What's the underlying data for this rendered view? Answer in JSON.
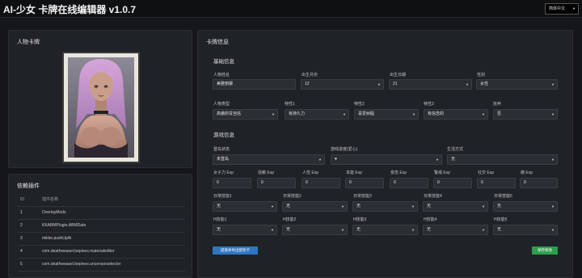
{
  "app": {
    "title": "AI-少女 卡牌在线编辑器 v1.0.7",
    "language": "简体中文"
  },
  "card_panel": {
    "title": "人物卡牌"
  },
  "deps_panel": {
    "title": "依赖插件",
    "columns": [
      "ID",
      "插件名称"
    ],
    "rows": [
      [
        "1",
        "OverlayMods"
      ],
      [
        "2",
        "KKABMPlugin.ABMData"
      ],
      [
        "3",
        "mikke.pushUpAI"
      ],
      [
        "4",
        "com.deathweasel.bepinex.materialeditor"
      ],
      [
        "5",
        "com.deathweasel.bepinex.uncensorselector"
      ]
    ]
  },
  "info_panel": {
    "title": "卡牌信息",
    "basic": {
      "title": "基础信息",
      "name_label": "人物姓名",
      "name_value": "美雅丽娜",
      "month_label": "出生月份",
      "month_value": "12",
      "day_label": "出生日期",
      "day_value": "21",
      "gender_label": "性别",
      "gender_value": "女性",
      "personality_label": "人物类型",
      "personality_value": "高傲的甘自信",
      "trait1_label": "特性1",
      "trait1_value": "有持久力",
      "trait2_label": "特性2",
      "trait2_value": "喜爱树脂",
      "trait3_label": "特性3",
      "trait3_value": "有信念的",
      "blood_label": "抚养",
      "blood_value": "否"
    },
    "game": {
      "title": "游戏信息",
      "status_label": "登岛状态",
      "status_value": "未登岛",
      "fav_label": "游戏进度(爱心)",
      "fav_value": "♥",
      "life_label": "生活方式",
      "life_value": "无",
      "exps": [
        {
          "label": "女子力 Exp",
          "value": "0"
        },
        {
          "label": "信赖 Exp",
          "value": "0"
        },
        {
          "label": "人性 Exp",
          "value": "0"
        },
        {
          "label": "本能 Exp",
          "value": "0"
        },
        {
          "label": "变态 Exp",
          "value": "0"
        },
        {
          "label": "警戒 Exp",
          "value": "0"
        },
        {
          "label": "社交 Exp",
          "value": "0"
        },
        {
          "label": "瘾 Exp",
          "value": "0"
        }
      ],
      "daily": [
        {
          "label": "日常技能1",
          "value": "无"
        },
        {
          "label": "日常技能2",
          "value": "无"
        },
        {
          "label": "日常技能3",
          "value": "无"
        },
        {
          "label": "日常技能4",
          "value": "无"
        },
        {
          "label": "日常技能5",
          "value": "无"
        }
      ],
      "h": [
        {
          "label": "H技能1",
          "value": "无"
        },
        {
          "label": "H技能2",
          "value": "无"
        },
        {
          "label": "H技能3",
          "value": "无"
        },
        {
          "label": "H技能4",
          "value": "无"
        },
        {
          "label": "H技能5",
          "value": "无"
        }
      ]
    },
    "extract_button": "提取并导出配装卡",
    "save_button": "保存修改"
  }
}
